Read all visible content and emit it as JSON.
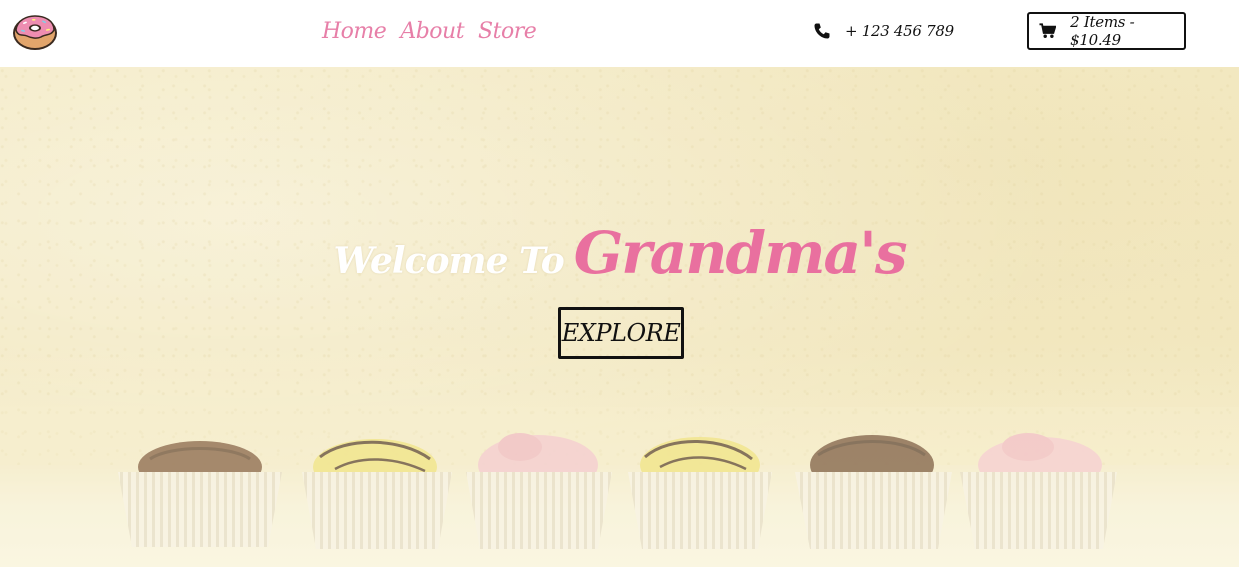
{
  "nav": {
    "logo_icon": "donut-icon",
    "links": [
      "Home",
      "About",
      "Store"
    ],
    "link_color": "#e77fa8",
    "phone_icon": "phone-icon",
    "phone": "+ 123 456 789",
    "cart_icon": "shopping-cart-icon",
    "cart": "2 Items - $10.49"
  },
  "hero": {
    "welcome_prefix": "Welcome To",
    "welcome_brand": "Grandma's",
    "brand_color": "#e9709f",
    "explore_label": "EXPLORE",
    "background": "cupcakes-photo"
  }
}
